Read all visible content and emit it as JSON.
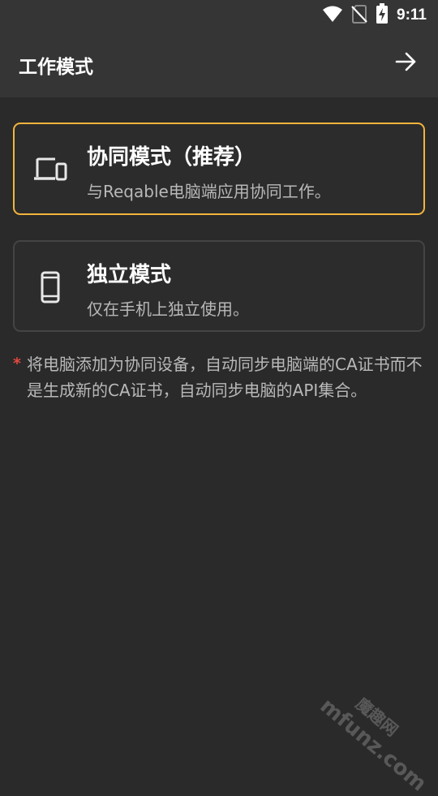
{
  "status_bar": {
    "time": "9:11",
    "icons": [
      "wifi-icon",
      "no-sim-icon",
      "battery-charging-icon"
    ]
  },
  "app_bar": {
    "title": "工作模式",
    "next_icon": "arrow-right-icon"
  },
  "modes": [
    {
      "title": "协同模式（推荐）",
      "description": "与Reqable电脑端应用协同工作。",
      "icon": "devices-icon",
      "selected": true
    },
    {
      "title": "独立模式",
      "description": "仅在手机上独立使用。",
      "icon": "phone-icon",
      "selected": false
    }
  ],
  "note": {
    "marker": "*",
    "text": "将电脑添加为协同设备，自动同步电脑端的CA证书而不是生成新的CA证书，自动同步电脑的API集合。"
  },
  "watermark": {
    "domain": "mfunz.com",
    "chinese": "魔趣网"
  },
  "colors": {
    "background": "#2a2a2a",
    "app_bar": "#353535",
    "selected_border": "#f2b43c",
    "card_border": "#444444",
    "asterisk": "#e5483f"
  }
}
